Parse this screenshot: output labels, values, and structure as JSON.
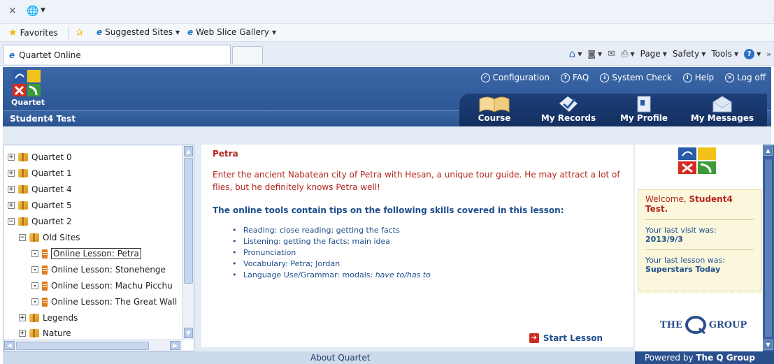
{
  "browser": {
    "favorites_label": "Favorites",
    "fav_items": [
      {
        "label": "Suggested Sites"
      },
      {
        "label": "Web Slice Gallery"
      }
    ],
    "tab_title": "Quartet Online",
    "commands": {
      "page": "Page",
      "safety": "Safety",
      "tools": "Tools",
      "more": "»"
    }
  },
  "header": {
    "logo_text": "Quartet",
    "student_name": "Student4 Test",
    "top_links": [
      {
        "label": "Configuration",
        "icon": "✓"
      },
      {
        "label": "FAQ",
        "icon": "?"
      },
      {
        "label": "System Check",
        "icon": "↓"
      },
      {
        "label": "Help",
        "icon": "i"
      },
      {
        "label": "Log off",
        "icon": "×"
      }
    ],
    "nav": [
      {
        "label": "Course"
      },
      {
        "label": "My Records"
      },
      {
        "label": "My Profile"
      },
      {
        "label": "My Messages"
      }
    ]
  },
  "tree": {
    "nodes": [
      {
        "label": "Quartet 0"
      },
      {
        "label": "Quartet 1"
      },
      {
        "label": "Quartet 4"
      },
      {
        "label": "Quartet 5"
      },
      {
        "label": "Quartet 2"
      },
      {
        "label": "Old Sites"
      },
      {
        "label": "Online Lesson: Petra"
      },
      {
        "label": "Online Lesson: Stonehenge"
      },
      {
        "label": "Online Lesson: Machu Picchu"
      },
      {
        "label": "Online Lesson: The Great Wall"
      },
      {
        "label": "Legends"
      },
      {
        "label": "Nature"
      }
    ]
  },
  "lesson": {
    "title": "Petra",
    "description": "Enter the ancient Nabatean city of Petra with Hesan, a unique tour guide. He may attract a lot of flies, but he definitely knows Petra well!",
    "skills_heading": "The online tools contain tips on the following skills covered in this lesson:",
    "skills": [
      "Reading: close reading; getting the facts",
      "Listening: getting the facts; main idea",
      "Pronunciation",
      "Vocabulary: Petra; Jordan"
    ],
    "grammar_prefix": "Language Use/Grammar: modals: ",
    "grammar_italic": "have to/has to",
    "start_label": "Start Lesson"
  },
  "sidebar": {
    "welcome_prefix": "Welcome, ",
    "welcome_name": "Student4 Test.",
    "last_visit_label": "Your last visit was:",
    "last_visit_value": "2013/9/3",
    "last_lesson_label": "Your last lesson was:",
    "last_lesson_value": "Superstars Today",
    "partner_logo_left": "THE",
    "partner_logo_right": "GROUP"
  },
  "footer": {
    "about": "About Quartet",
    "powered_prefix": "Powered by ",
    "powered_name": "The Q Group"
  },
  "colors": {
    "header_blue": "#2f5a9a",
    "lesson_red": "#b3261e",
    "text_blue": "#1e4e8c",
    "card_cream": "#fbf7dd"
  }
}
